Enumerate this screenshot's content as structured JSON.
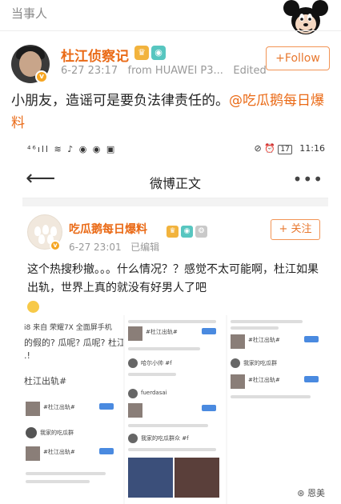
{
  "page": {
    "section_label": "当事人"
  },
  "post": {
    "username": "杜江侦察记",
    "timestamp": "6-27 23:17",
    "source": "from HUAWEI P3...",
    "edited_label": "Edited",
    "follow_label": "+Follow",
    "text_main": "小朋友，造谣可是要负法律责任的。",
    "mention": "@吃瓜鹅每日爆料"
  },
  "screenshot": {
    "status_left": "⁴⁶ıll ≋ ♪ ◉ ◉ ▣",
    "status_battery": "17",
    "status_time": "11:16",
    "nav_title": "微博正文",
    "inner_post": {
      "username": "吃瓜鹅每日爆料",
      "timestamp": "6-27 23:01",
      "edited_label": "已编辑",
      "follow_label": "+ 关注",
      "text": "这个热搜秒撤。。。什么情况？？感觉不太可能啊，杜江如果出轨，世界上真的就没有好男人了吧"
    },
    "collage": {
      "p1_line1": "i8  来自 荣耀7X 全面屏手机",
      "p1_line2": "的假的? 瓜呢? 瓜呢? 杜江和",
      "p1_line3": ".!",
      "p1_hashtag": "杜江出轨#",
      "p1_item1": "#杜江出轨#",
      "p1_item2": "我家的吃瓜群",
      "p1_item3": "#杜江出轨#",
      "p2_item1": "#杜江出轨#",
      "p2_item2": "哈尔小帅 #f",
      "p2_item3": "fuerdasai",
      "p2_item4": "我家的吃瓜群众 #f",
      "p3_item1": "#杜江出轨#",
      "p3_item2": "我家的吃瓜群",
      "p3_item3": "#杜江出轨#",
      "watermark": "恩美"
    }
  },
  "colors": {
    "accent_orange": "#ea6a16",
    "follow_border": "#f29455",
    "meta_gray": "#999999"
  }
}
